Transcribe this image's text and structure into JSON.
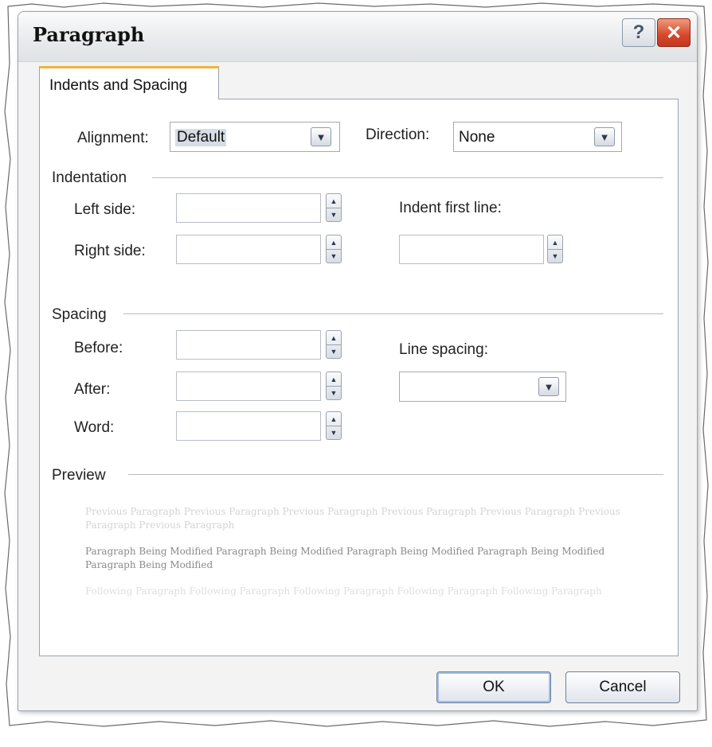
{
  "dialog": {
    "title": "Paragraph",
    "help_label": "?",
    "close_label": "✕"
  },
  "tabs": [
    {
      "label": "Indents and Spacing",
      "active": true
    }
  ],
  "general": {
    "alignment_label": "Alignment:",
    "alignment_value": "Default",
    "direction_label": "Direction:",
    "direction_value": "None"
  },
  "indentation": {
    "section_label": "Indentation",
    "left_label": "Left side:",
    "left_value": "",
    "right_label": "Right side:",
    "right_value": "",
    "first_line_label": "Indent first line:",
    "first_line_value": ""
  },
  "spacing": {
    "section_label": "Spacing",
    "before_label": "Before:",
    "before_value": "",
    "after_label": "After:",
    "after_value": "",
    "word_label": "Word:",
    "word_value": "",
    "line_spacing_label": "Line spacing:",
    "line_spacing_value": ""
  },
  "preview": {
    "section_label": "Preview",
    "previous_paragraph": "Previous Paragraph Previous Paragraph Previous Paragraph Previous Paragraph Previous Paragraph Previous Paragraph Previous Paragraph",
    "current_paragraph": "Paragraph Being Modified Paragraph Being Modified Paragraph Being Modified Paragraph Being Modified Paragraph Being Modified",
    "following_paragraph": "Following Paragraph Following Paragraph Following Paragraph Following Paragraph Following Paragraph"
  },
  "buttons": {
    "ok": "OK",
    "cancel": "Cancel"
  },
  "icons": {
    "help": "help-icon",
    "close": "close-icon",
    "dropdown": "chevron-down-icon",
    "spinner": "spinner-arrows-icon"
  },
  "colors": {
    "close_button": "#d6462a",
    "tab_accent": "#f2b534",
    "ok_focus": "#9fc0ea"
  }
}
